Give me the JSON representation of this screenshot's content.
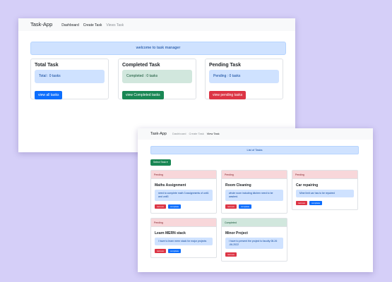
{
  "window1": {
    "nav": {
      "brand": "Task-App",
      "links": [
        "Dashboard",
        "Create Task",
        "Views Task"
      ]
    },
    "welcome": "welcome to task manager",
    "cards": [
      {
        "title": "Total Task",
        "info": "Total : 0 tasks",
        "button": "view all tasks"
      },
      {
        "title": "Completed Task",
        "info": "Completed : 0 tasks",
        "button": "view Completed tasks"
      },
      {
        "title": "Pending Task",
        "info": "Pending : 0 tasks",
        "button": "view pending tasks"
      }
    ]
  },
  "window2": {
    "nav": {
      "brand": "Task-App",
      "links": [
        "Dashboard",
        "Create Task",
        "View Task"
      ]
    },
    "list_title": "List of Tasks",
    "select_button": "Select Task ▾",
    "tasks": [
      {
        "status": "Pending",
        "title": "Maths Assignment",
        "desc": "need to complete math 3 assignments of unit1 and unit3",
        "delete": "remove",
        "complete": "complete"
      },
      {
        "status": "Pending",
        "title": "Room Cleaning",
        "desc": "whole room including kitchen need to be washed.",
        "delete": "remove",
        "complete": "complete"
      },
      {
        "status": "Pending",
        "title": "Car repairing",
        "desc": "Mine limit car has to be repaired",
        "delete": "remove",
        "complete": "complete"
      },
      {
        "status": "Pending",
        "title": "Learn MERN stack",
        "desc": "I have to learn mern stack for major projects",
        "delete": "remove",
        "complete": "complete"
      },
      {
        "status": "Completed",
        "title": "Minor Project",
        "desc": "I have to present the project to faculty 08-26 -06-2022",
        "delete": "remove"
      }
    ]
  },
  "colors": {
    "background": "#d5cff8",
    "primary": "#0d6efd",
    "success": "#198754",
    "danger": "#dc3545",
    "info_bg": "#cfe2ff",
    "success_bg": "#d1e7dd",
    "pending_bg": "#f8d7da"
  }
}
